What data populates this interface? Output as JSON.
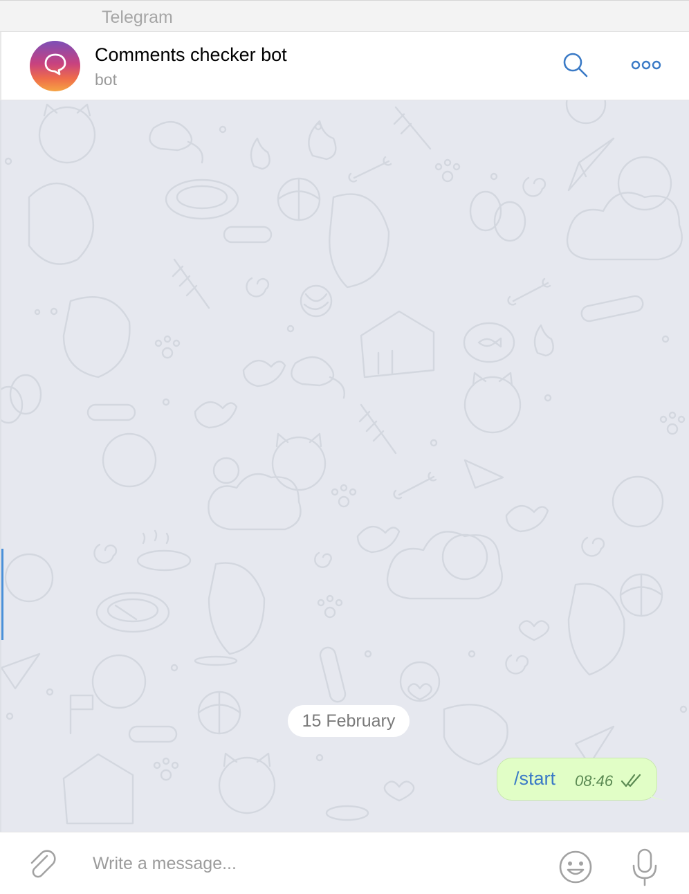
{
  "window": {
    "title": "Telegram"
  },
  "chat": {
    "name": "Comments checker bot",
    "status": "bot",
    "avatar_colors": [
      "#7c4fb7",
      "#c8427f",
      "#ef6d4a",
      "#f5a443"
    ]
  },
  "header": {
    "search_icon": "search-icon",
    "more_icon": "more-icon"
  },
  "messages": {
    "date_separator": "15 February",
    "items": [
      {
        "text": "/start",
        "time": "08:46",
        "direction": "outgoing",
        "status": "read",
        "bubble_color": "#e1fec6"
      }
    ]
  },
  "composer": {
    "placeholder": "Write a message...",
    "attach_icon": "paperclip-icon",
    "emoji_icon": "emoji-icon",
    "mic_icon": "microphone-icon"
  },
  "colors": {
    "accent": "#3a7ac6",
    "chat_background": "#e6e8ef"
  }
}
